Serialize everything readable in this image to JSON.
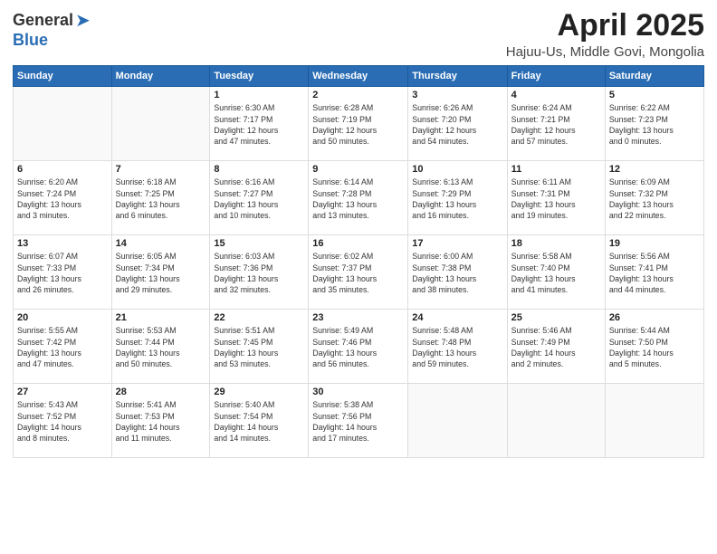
{
  "header": {
    "logo_general": "General",
    "logo_blue": "Blue",
    "title": "April 2025",
    "subtitle": "Hajuu-Us, Middle Govi, Mongolia"
  },
  "days_of_week": [
    "Sunday",
    "Monday",
    "Tuesday",
    "Wednesday",
    "Thursday",
    "Friday",
    "Saturday"
  ],
  "weeks": [
    [
      {
        "day": "",
        "detail": ""
      },
      {
        "day": "",
        "detail": ""
      },
      {
        "day": "1",
        "detail": "Sunrise: 6:30 AM\nSunset: 7:17 PM\nDaylight: 12 hours\nand 47 minutes."
      },
      {
        "day": "2",
        "detail": "Sunrise: 6:28 AM\nSunset: 7:19 PM\nDaylight: 12 hours\nand 50 minutes."
      },
      {
        "day": "3",
        "detail": "Sunrise: 6:26 AM\nSunset: 7:20 PM\nDaylight: 12 hours\nand 54 minutes."
      },
      {
        "day": "4",
        "detail": "Sunrise: 6:24 AM\nSunset: 7:21 PM\nDaylight: 12 hours\nand 57 minutes."
      },
      {
        "day": "5",
        "detail": "Sunrise: 6:22 AM\nSunset: 7:23 PM\nDaylight: 13 hours\nand 0 minutes."
      }
    ],
    [
      {
        "day": "6",
        "detail": "Sunrise: 6:20 AM\nSunset: 7:24 PM\nDaylight: 13 hours\nand 3 minutes."
      },
      {
        "day": "7",
        "detail": "Sunrise: 6:18 AM\nSunset: 7:25 PM\nDaylight: 13 hours\nand 6 minutes."
      },
      {
        "day": "8",
        "detail": "Sunrise: 6:16 AM\nSunset: 7:27 PM\nDaylight: 13 hours\nand 10 minutes."
      },
      {
        "day": "9",
        "detail": "Sunrise: 6:14 AM\nSunset: 7:28 PM\nDaylight: 13 hours\nand 13 minutes."
      },
      {
        "day": "10",
        "detail": "Sunrise: 6:13 AM\nSunset: 7:29 PM\nDaylight: 13 hours\nand 16 minutes."
      },
      {
        "day": "11",
        "detail": "Sunrise: 6:11 AM\nSunset: 7:31 PM\nDaylight: 13 hours\nand 19 minutes."
      },
      {
        "day": "12",
        "detail": "Sunrise: 6:09 AM\nSunset: 7:32 PM\nDaylight: 13 hours\nand 22 minutes."
      }
    ],
    [
      {
        "day": "13",
        "detail": "Sunrise: 6:07 AM\nSunset: 7:33 PM\nDaylight: 13 hours\nand 26 minutes."
      },
      {
        "day": "14",
        "detail": "Sunrise: 6:05 AM\nSunset: 7:34 PM\nDaylight: 13 hours\nand 29 minutes."
      },
      {
        "day": "15",
        "detail": "Sunrise: 6:03 AM\nSunset: 7:36 PM\nDaylight: 13 hours\nand 32 minutes."
      },
      {
        "day": "16",
        "detail": "Sunrise: 6:02 AM\nSunset: 7:37 PM\nDaylight: 13 hours\nand 35 minutes."
      },
      {
        "day": "17",
        "detail": "Sunrise: 6:00 AM\nSunset: 7:38 PM\nDaylight: 13 hours\nand 38 minutes."
      },
      {
        "day": "18",
        "detail": "Sunrise: 5:58 AM\nSunset: 7:40 PM\nDaylight: 13 hours\nand 41 minutes."
      },
      {
        "day": "19",
        "detail": "Sunrise: 5:56 AM\nSunset: 7:41 PM\nDaylight: 13 hours\nand 44 minutes."
      }
    ],
    [
      {
        "day": "20",
        "detail": "Sunrise: 5:55 AM\nSunset: 7:42 PM\nDaylight: 13 hours\nand 47 minutes."
      },
      {
        "day": "21",
        "detail": "Sunrise: 5:53 AM\nSunset: 7:44 PM\nDaylight: 13 hours\nand 50 minutes."
      },
      {
        "day": "22",
        "detail": "Sunrise: 5:51 AM\nSunset: 7:45 PM\nDaylight: 13 hours\nand 53 minutes."
      },
      {
        "day": "23",
        "detail": "Sunrise: 5:49 AM\nSunset: 7:46 PM\nDaylight: 13 hours\nand 56 minutes."
      },
      {
        "day": "24",
        "detail": "Sunrise: 5:48 AM\nSunset: 7:48 PM\nDaylight: 13 hours\nand 59 minutes."
      },
      {
        "day": "25",
        "detail": "Sunrise: 5:46 AM\nSunset: 7:49 PM\nDaylight: 14 hours\nand 2 minutes."
      },
      {
        "day": "26",
        "detail": "Sunrise: 5:44 AM\nSunset: 7:50 PM\nDaylight: 14 hours\nand 5 minutes."
      }
    ],
    [
      {
        "day": "27",
        "detail": "Sunrise: 5:43 AM\nSunset: 7:52 PM\nDaylight: 14 hours\nand 8 minutes."
      },
      {
        "day": "28",
        "detail": "Sunrise: 5:41 AM\nSunset: 7:53 PM\nDaylight: 14 hours\nand 11 minutes."
      },
      {
        "day": "29",
        "detail": "Sunrise: 5:40 AM\nSunset: 7:54 PM\nDaylight: 14 hours\nand 14 minutes."
      },
      {
        "day": "30",
        "detail": "Sunrise: 5:38 AM\nSunset: 7:56 PM\nDaylight: 14 hours\nand 17 minutes."
      },
      {
        "day": "",
        "detail": ""
      },
      {
        "day": "",
        "detail": ""
      },
      {
        "day": "",
        "detail": ""
      }
    ]
  ]
}
